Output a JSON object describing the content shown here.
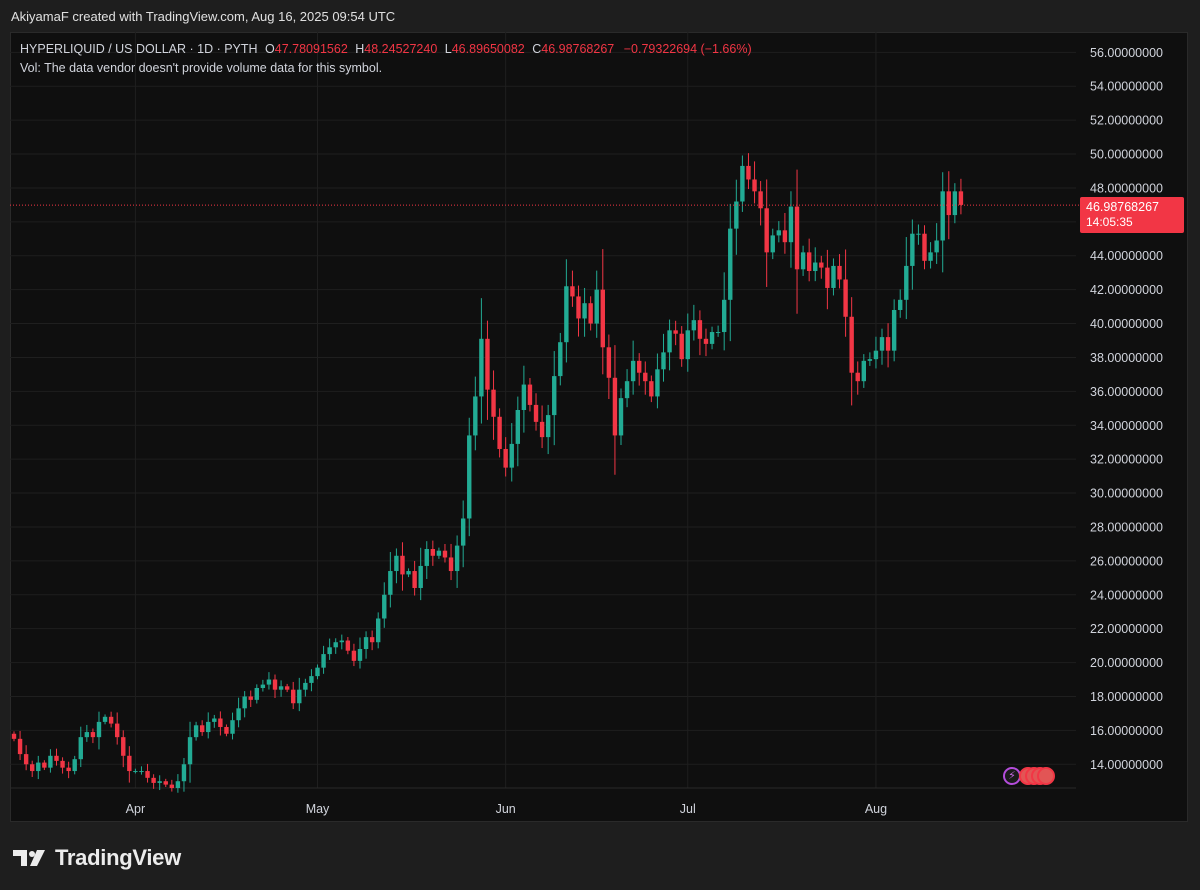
{
  "header": {
    "caption": "AkiyamaF created with TradingView.com, Aug 16, 2025 09:54 UTC"
  },
  "legend": {
    "symbol": "HYPERLIQUID / US DOLLAR · 1D · PYTH",
    "open_label": "O",
    "open": "47.78091562",
    "high_label": "H",
    "high": "48.24527240",
    "low_label": "L",
    "low": "46.89650082",
    "close_label": "C",
    "close": "46.98768267",
    "change": "−0.79322694 (−1.66%)",
    "volume_note": "Vol: The data vendor doesn't provide volume data for this symbol."
  },
  "price_tag": {
    "price": "46.98768267",
    "countdown": "14:05:35"
  },
  "footer": {
    "brand": "TradingView"
  },
  "colors": {
    "up": "#22ab94",
    "down": "#f23645",
    "background": "#0f0f0f",
    "grid": "#1f1f1f"
  },
  "chart_data": {
    "type": "candlestick",
    "ylim": [
      12.6,
      57.2
    ],
    "y_ticks": [
      "56.00000000",
      "54.00000000",
      "52.00000000",
      "50.00000000",
      "48.00000000",
      "46.00000000",
      "44.00000000",
      "42.00000000",
      "40.00000000",
      "38.00000000",
      "36.00000000",
      "34.00000000",
      "32.00000000",
      "30.00000000",
      "28.00000000",
      "26.00000000",
      "24.00000000",
      "22.00000000",
      "20.00000000",
      "18.00000000",
      "16.00000000",
      "14.00000000"
    ],
    "y_tick_values": [
      56,
      54,
      52,
      50,
      48,
      46,
      44,
      42,
      40,
      38,
      36,
      34,
      32,
      30,
      28,
      26,
      24,
      22,
      20,
      18,
      16,
      14
    ],
    "x_ticks": [
      {
        "label": "Apr",
        "date": "2025-04-01"
      },
      {
        "label": "May",
        "date": "2025-05-01"
      },
      {
        "label": "Jun",
        "date": "2025-06-01"
      },
      {
        "label": "Jul",
        "date": "2025-07-01"
      },
      {
        "label": "Aug",
        "date": "2025-08-01"
      }
    ],
    "last_price": 46.98768267,
    "dates": [
      "2025-03-12",
      "2025-03-13",
      "2025-03-14",
      "2025-03-15",
      "2025-03-16",
      "2025-03-17",
      "2025-03-18",
      "2025-03-19",
      "2025-03-20",
      "2025-03-21",
      "2025-03-22",
      "2025-03-23",
      "2025-03-24",
      "2025-03-25",
      "2025-03-26",
      "2025-03-27",
      "2025-03-28",
      "2025-03-29",
      "2025-03-30",
      "2025-03-31",
      "2025-04-01",
      "2025-04-02",
      "2025-04-03",
      "2025-04-04",
      "2025-04-05",
      "2025-04-06",
      "2025-04-07",
      "2025-04-08",
      "2025-04-09",
      "2025-04-10",
      "2025-04-11",
      "2025-04-12",
      "2025-04-13",
      "2025-04-14",
      "2025-04-15",
      "2025-04-16",
      "2025-04-17",
      "2025-04-18",
      "2025-04-19",
      "2025-04-20",
      "2025-04-21",
      "2025-04-22",
      "2025-04-23",
      "2025-04-24",
      "2025-04-25",
      "2025-04-26",
      "2025-04-27",
      "2025-04-28",
      "2025-04-29",
      "2025-04-30",
      "2025-05-01",
      "2025-05-02",
      "2025-05-03",
      "2025-05-04",
      "2025-05-05",
      "2025-05-06",
      "2025-05-07",
      "2025-05-08",
      "2025-05-09",
      "2025-05-10",
      "2025-05-11",
      "2025-05-12",
      "2025-05-13",
      "2025-05-14",
      "2025-05-15",
      "2025-05-16",
      "2025-05-17",
      "2025-05-18",
      "2025-05-19",
      "2025-05-20",
      "2025-05-21",
      "2025-05-22",
      "2025-05-23",
      "2025-05-24",
      "2025-05-25",
      "2025-05-26",
      "2025-05-27",
      "2025-05-28",
      "2025-05-29",
      "2025-05-30",
      "2025-05-31",
      "2025-06-01",
      "2025-06-02",
      "2025-06-03",
      "2025-06-04",
      "2025-06-05",
      "2025-06-06",
      "2025-06-07",
      "2025-06-08",
      "2025-06-09",
      "2025-06-10",
      "2025-06-11",
      "2025-06-12",
      "2025-06-13",
      "2025-06-14",
      "2025-06-15",
      "2025-06-16",
      "2025-06-17",
      "2025-06-18",
      "2025-06-19",
      "2025-06-20",
      "2025-06-21",
      "2025-06-22",
      "2025-06-23",
      "2025-06-24",
      "2025-06-25",
      "2025-06-26",
      "2025-06-27",
      "2025-06-28",
      "2025-06-29",
      "2025-06-30",
      "2025-07-01",
      "2025-07-02",
      "2025-07-03",
      "2025-07-04",
      "2025-07-05",
      "2025-07-06",
      "2025-07-07",
      "2025-07-08",
      "2025-07-09",
      "2025-07-10",
      "2025-07-11",
      "2025-07-12",
      "2025-07-13",
      "2025-07-14",
      "2025-07-15",
      "2025-07-16",
      "2025-07-17",
      "2025-07-18",
      "2025-07-19",
      "2025-07-20",
      "2025-07-21",
      "2025-07-22",
      "2025-07-23",
      "2025-07-24",
      "2025-07-25",
      "2025-07-26",
      "2025-07-27",
      "2025-07-28",
      "2025-07-29",
      "2025-07-30",
      "2025-07-31",
      "2025-08-01",
      "2025-08-02",
      "2025-08-03",
      "2025-08-04",
      "2025-08-05",
      "2025-08-06",
      "2025-08-07",
      "2025-08-08",
      "2025-08-09",
      "2025-08-10",
      "2025-08-11",
      "2025-08-12",
      "2025-08-13",
      "2025-08-14",
      "2025-08-15",
      "2025-08-16"
    ],
    "closes": [
      15.5,
      14.6,
      14.0,
      13.6,
      14.1,
      13.8,
      14.5,
      14.2,
      13.8,
      13.6,
      14.3,
      15.6,
      15.9,
      15.6,
      16.5,
      16.8,
      16.4,
      15.6,
      14.5,
      13.6,
      13.6,
      13.6,
      13.2,
      12.9,
      13.0,
      12.8,
      12.6,
      13.0,
      14.0,
      15.6,
      16.3,
      15.9,
      16.5,
      16.7,
      16.2,
      15.8,
      16.6,
      17.3,
      18.0,
      17.8,
      18.5,
      18.7,
      19.0,
      18.4,
      18.6,
      18.4,
      17.6,
      18.4,
      18.8,
      19.2,
      19.7,
      20.5,
      20.9,
      21.2,
      21.3,
      20.7,
      20.1,
      20.8,
      21.5,
      21.2,
      22.6,
      24.0,
      25.4,
      26.3,
      25.2,
      25.4,
      24.4,
      25.7,
      26.7,
      26.3,
      26.6,
      26.2,
      25.4,
      26.9,
      28.5,
      33.4,
      35.7,
      39.1,
      36.1,
      34.5,
      32.6,
      31.5,
      32.9,
      34.9,
      36.4,
      35.2,
      34.2,
      33.3,
      34.6,
      36.9,
      38.9,
      42.2,
      41.6,
      40.3,
      41.2,
      40.0,
      42.0,
      38.6,
      36.8,
      33.4,
      35.6,
      36.6,
      37.8,
      37.1,
      36.6,
      35.7,
      37.3,
      38.3,
      39.6,
      39.4,
      37.9,
      39.6,
      40.2,
      39.1,
      38.8,
      39.5,
      39.5,
      41.4,
      45.6,
      47.2,
      49.3,
      48.5,
      47.8,
      46.8,
      44.2,
      45.2,
      45.5,
      44.8,
      46.9,
      43.2,
      44.2,
      43.1,
      43.6,
      43.3,
      42.1,
      43.4,
      42.6,
      40.4,
      37.1,
      36.6,
      37.8,
      37.9,
      38.4,
      39.2,
      38.4,
      40.8,
      41.4,
      43.4,
      45.3,
      45.3,
      43.7,
      44.2,
      44.9,
      47.8,
      46.4,
      47.8,
      47.0
    ],
    "candles_note": ""
  }
}
